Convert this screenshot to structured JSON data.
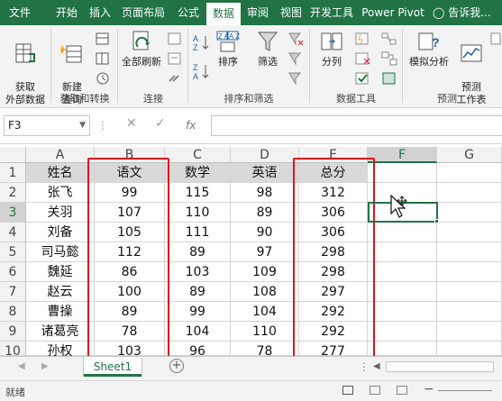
{
  "ribbon_tabs": [
    "文件",
    "开始",
    "插入",
    "页面布局",
    "公式",
    "数据",
    "审阅",
    "视图",
    "开发工具",
    "Power Pivot"
  ],
  "tell_me": "告诉我...",
  "ribbon": {
    "get_external": "获取\n外部数据",
    "new_query": "新建\n查询",
    "refresh_all": "全部刷新",
    "sort": "排序",
    "filter": "筛选",
    "text_to_columns": "分列",
    "what_if": "模拟分析",
    "forecast_sheet": "预测\n工作表",
    "groups": {
      "get_transform": "获取和转换",
      "connections": "连接",
      "sort_filter": "排序和筛选",
      "data_tools": "数据工具",
      "forecast": "预测"
    }
  },
  "name_box": "F3",
  "formula_icon": "fx",
  "columns": [
    "A",
    "B",
    "C",
    "D",
    "E",
    "F",
    "G"
  ],
  "rows": [
    "1",
    "2",
    "3",
    "4",
    "5",
    "6",
    "7",
    "8",
    "9",
    "10"
  ],
  "table": {
    "headers": [
      "姓名",
      "语文",
      "数学",
      "英语",
      "总分"
    ],
    "data": [
      [
        "张飞",
        "99",
        "115",
        "98",
        "312"
      ],
      [
        "关羽",
        "107",
        "110",
        "89",
        "306"
      ],
      [
        "刘备",
        "105",
        "111",
        "90",
        "306"
      ],
      [
        "司马懿",
        "112",
        "89",
        "97",
        "298"
      ],
      [
        "魏延",
        "86",
        "103",
        "109",
        "298"
      ],
      [
        "赵云",
        "100",
        "89",
        "108",
        "297"
      ],
      [
        "曹操",
        "89",
        "99",
        "104",
        "292"
      ],
      [
        "诸葛亮",
        "78",
        "104",
        "110",
        "292"
      ],
      [
        "孙权",
        "103",
        "96",
        "78",
        "277"
      ]
    ]
  },
  "sheet_tab": "Sheet1",
  "status": "就绪",
  "colors": {
    "accent": "#217346",
    "highlight": "#e0121f",
    "header_fill": "#d9d9d9"
  }
}
